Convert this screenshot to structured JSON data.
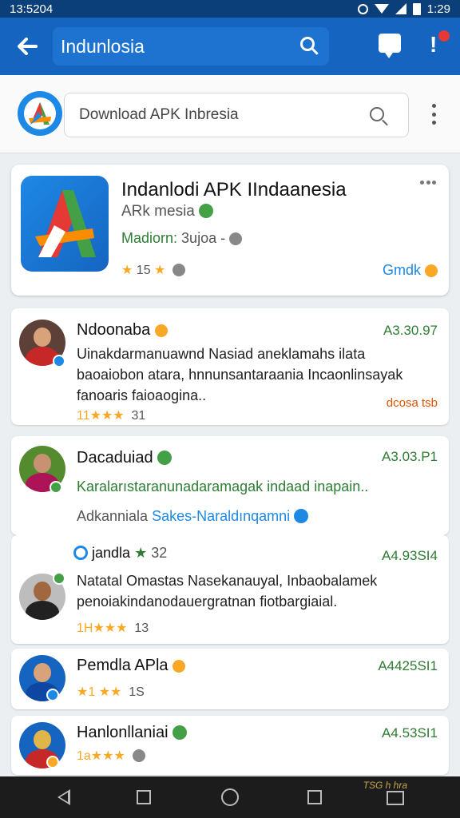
{
  "status_bar": {
    "time_left": "13:5204",
    "time_right": "1:29"
  },
  "app_bar": {
    "search_text": "Indunlosia"
  },
  "search": {
    "value": "Download APK Inbresia"
  },
  "app_card": {
    "title": "Indanlodi APK IIndaanesia",
    "subtitle": "ARk mesia",
    "category": "Madiorn:",
    "category_extra": "3ujoa -",
    "rating_value": "15",
    "action_label": "Gmdk",
    "icon_colors": {
      "blue": "#1e88e5",
      "red": "#e53935",
      "green": "#43a047",
      "orange": "#fb8c00"
    }
  },
  "reviews": [
    {
      "name": "Ndoonaba",
      "date": "A3.30.97",
      "text": "Uinakdarmanuawnd Nasiad aneklamahs ilata baoaiobon atara, hnnunsantaraania Incaonlinsayak fanoaris faioaogina..",
      "rating": "11★★★",
      "count": "31",
      "tag": "dcosa tsb"
    },
    {
      "name": "Dacaduiad",
      "date": "A3.03.P1",
      "text": "Karalarıstaranunadaramagak indaad inapain..",
      "footer_prefix": "Adkanniala",
      "footer_link": "Sakes-Naraldınqamni"
    },
    {
      "name": "jandla",
      "name_rating": "★",
      "name_count": "32",
      "date": "A4.93SI4",
      "text": "Natatal Omastas Nasekanauyal, Inbaobalamek penoiakindanodauergratnan fiotbargiaial.",
      "rating": "1H★★★",
      "count": "13"
    },
    {
      "name": "Pemdla APla",
      "date": "A4425SI1",
      "rating": "★1 ★★",
      "count": "1S"
    },
    {
      "name": "Hanlonllaniai",
      "date": "A4.53SI1",
      "rating": "1a★★★"
    }
  ],
  "nav_bar": {
    "watermark": "TSG h hra"
  }
}
